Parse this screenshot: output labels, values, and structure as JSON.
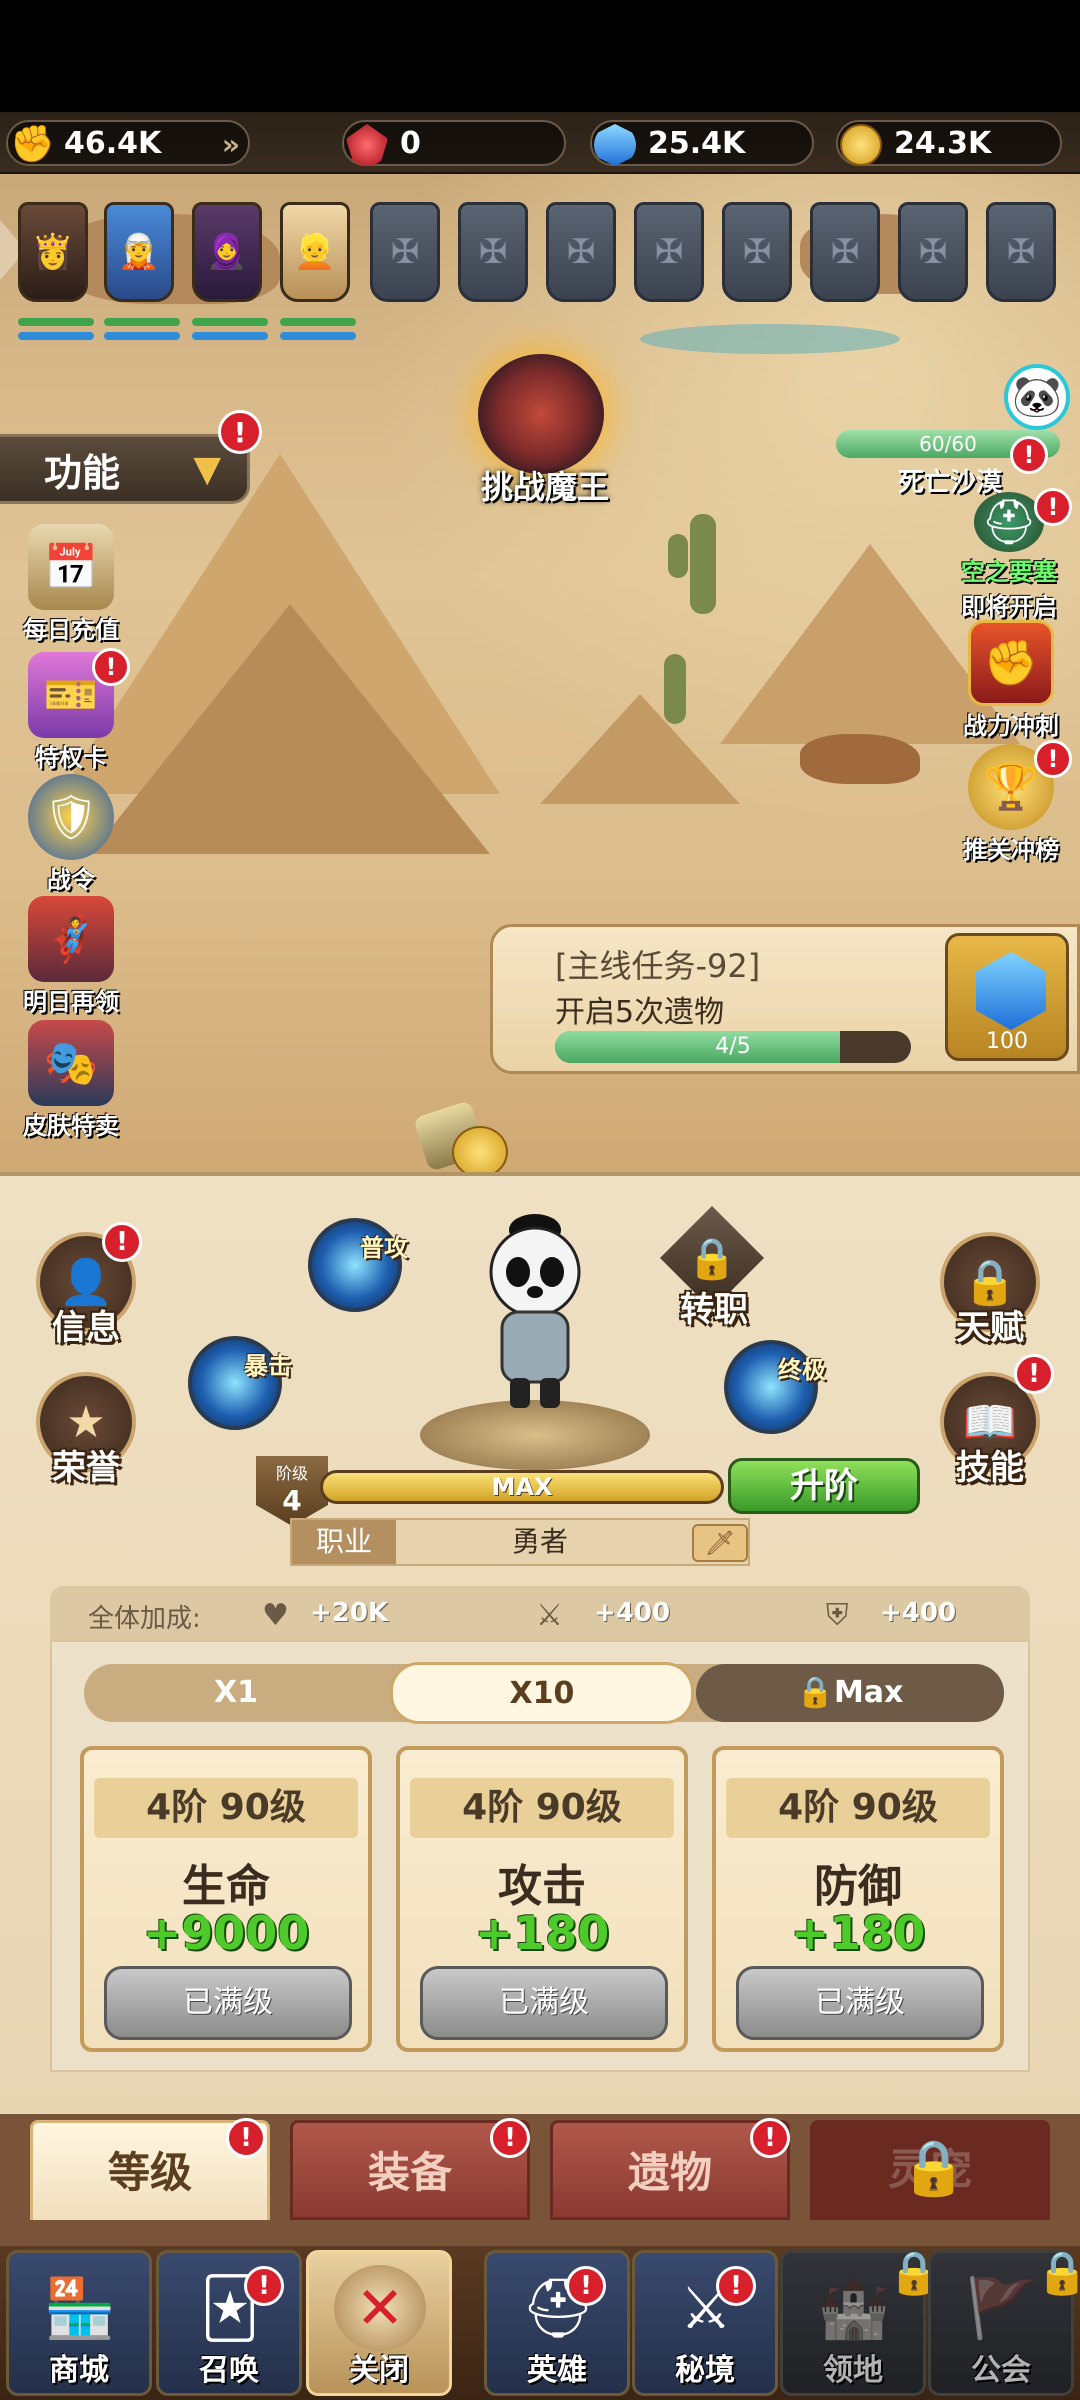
{
  "resources": {
    "power": "46.4K",
    "ruby": "0",
    "diamond": "25.4K",
    "gold": "24.3K"
  },
  "party": {
    "hero_slots": 4,
    "empty_slots": 8
  },
  "boss": {
    "label": "挑战魔王"
  },
  "function_menu": {
    "label": "功能"
  },
  "left_menu": [
    {
      "label": "每日充值",
      "icon": "calendar-icon"
    },
    {
      "label": "特权卡",
      "icon": "card-icon"
    },
    {
      "label": "战令",
      "icon": "medal-icon"
    },
    {
      "label": "明日再领",
      "icon": "heroes-icon"
    },
    {
      "label": "皮肤特卖",
      "icon": "skin-icon"
    }
  ],
  "right_menu": {
    "stage_progress": "60/60",
    "stage_name": "死亡沙漠",
    "fortress_title": "空之要塞",
    "fortress_status": "即将开启",
    "power_rush": "战力冲刺",
    "ranking": "推关冲榜"
  },
  "quest": {
    "title": "[主线任务-92]",
    "desc": "开启5次遗物",
    "progress_text": "4/5",
    "progress": 0.8,
    "reward_amount": "100"
  },
  "hero_panel": {
    "info": "信息",
    "honor": "荣誉",
    "transfer": "转职",
    "talent": "天赋",
    "skill": "技能",
    "skill_normal": "普攻",
    "skill_crit": "暴击",
    "skill_ultimate": "终极",
    "stage_label": "阶级",
    "stage_value": "4",
    "level_bar": "MAX",
    "upgrade": "升阶",
    "class_key": "职业",
    "class_value": "勇者"
  },
  "bonus": {
    "label": "全体加成:",
    "hp": "+20K",
    "atk": "+400",
    "def": "+400"
  },
  "multiplier": {
    "x1": "X1",
    "x10": "X10",
    "max": "Max"
  },
  "cards": [
    {
      "level": "4阶  90级",
      "name": "生命",
      "value": "+9000",
      "button": "已满级"
    },
    {
      "level": "4阶  90级",
      "name": "攻击",
      "value": "+180",
      "button": "已满级"
    },
    {
      "level": "4阶  90级",
      "name": "防御",
      "value": "+180",
      "button": "已满级"
    }
  ],
  "tabs": {
    "level": "等级",
    "equipment": "装备",
    "relic": "遗物",
    "locked": "灵宠"
  },
  "nav": {
    "shop": "商城",
    "summon": "召唤",
    "close": "关闭",
    "hero": "英雄",
    "secret": "秘境",
    "territory": "领地",
    "guild": "公会"
  },
  "colors": {
    "alert": "#d8202c",
    "progress": "#4aa862",
    "stat_value": "#4ecb2a"
  }
}
